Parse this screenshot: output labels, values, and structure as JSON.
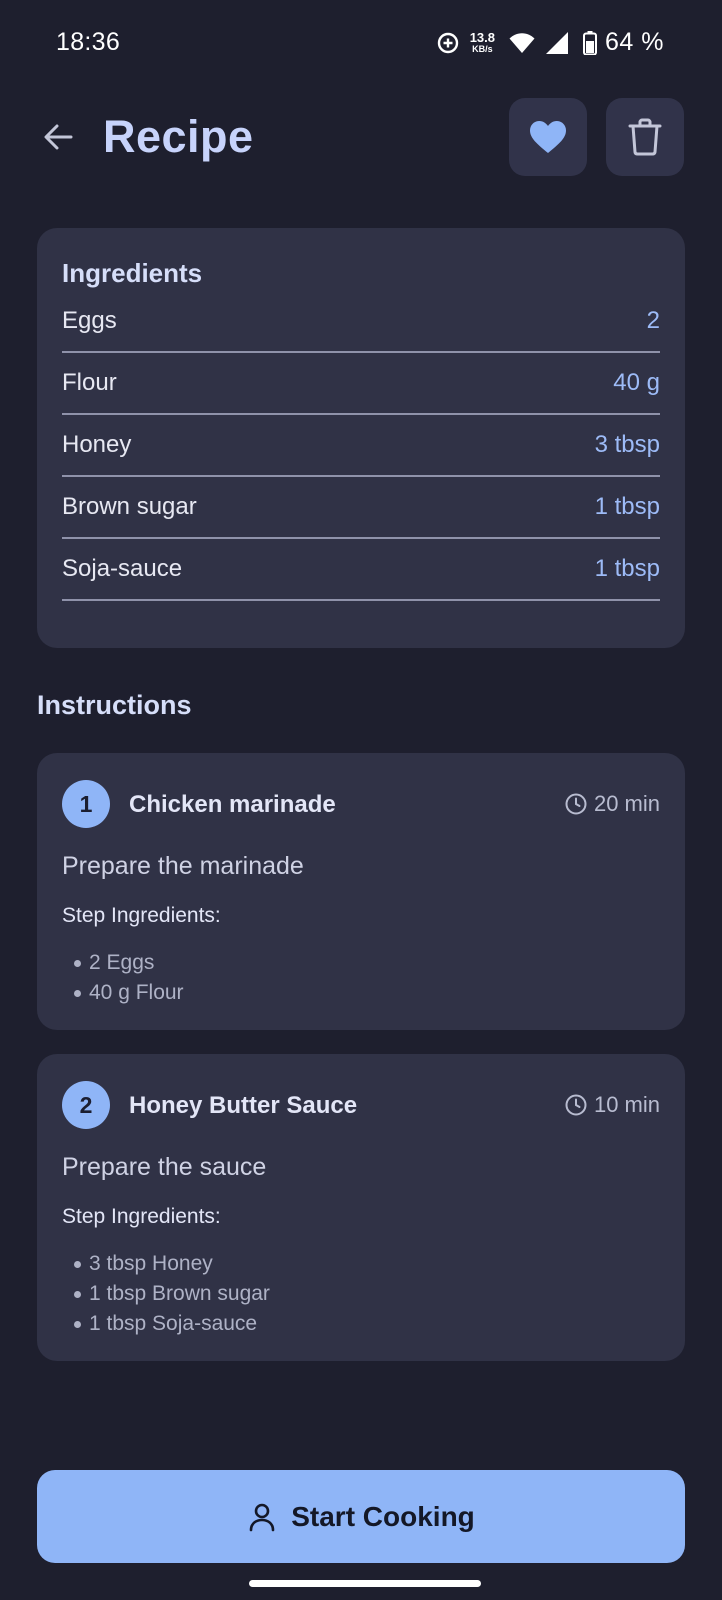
{
  "status_bar": {
    "time": "18:36",
    "net_speed_value": "13.8",
    "net_speed_unit": "KB/s",
    "battery": "64 %",
    "icons": [
      "data-saver-icon",
      "wifi-icon",
      "signal-icon",
      "battery-icon"
    ]
  },
  "app_bar": {
    "title": "Recipe",
    "back_icon": "arrow-back-icon",
    "favorite_icon": "heart-icon",
    "delete_icon": "trash-icon"
  },
  "ingredients": {
    "heading": "Ingredients",
    "items": [
      {
        "name": "Eggs",
        "qty": "2"
      },
      {
        "name": "Flour",
        "qty": "40 g"
      },
      {
        "name": "Honey",
        "qty": "3 tbsp"
      },
      {
        "name": "Brown sugar",
        "qty": "1 tbsp"
      },
      {
        "name": "Soja-sauce",
        "qty": "1 tbsp"
      }
    ]
  },
  "instructions": {
    "heading": "Instructions",
    "steps": [
      {
        "number": "1",
        "title": "Chicken marinade",
        "time": "20 min",
        "description": "Prepare the marinade",
        "ingredients_label": "Step Ingredients:",
        "ingredients": [
          "2 Eggs",
          "40 g Flour"
        ]
      },
      {
        "number": "2",
        "title": "Honey Butter Sauce",
        "time": "10 min",
        "description": "Prepare the sauce",
        "ingredients_label": "Step Ingredients:",
        "ingredients": [
          "3 tbsp Honey",
          "1 tbsp Brown sugar",
          "1 tbsp Soja-sauce"
        ]
      }
    ]
  },
  "start_button": {
    "label": "Start Cooking",
    "icon": "person-icon"
  },
  "colors": {
    "background": "#1e1f2e",
    "card": "#303246",
    "accent": "#8fb5f7",
    "title": "#c7d3fb",
    "quantity": "#9dbbf7"
  }
}
